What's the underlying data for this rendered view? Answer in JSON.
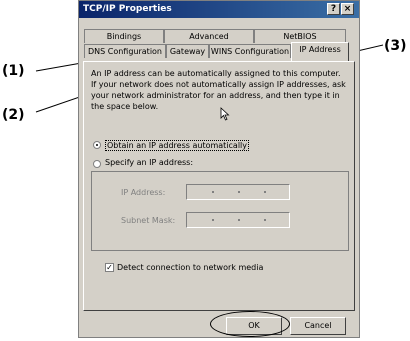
{
  "dialog": {
    "title": "TCP/IP Properties",
    "help_button": "?",
    "close_button": "×"
  },
  "tabs": {
    "row_back": [
      "Bindings",
      "Advanced",
      "NetBIOS"
    ],
    "row_front": [
      "DNS Configuration",
      "Gateway",
      "WINS Configuration",
      "IP Address"
    ]
  },
  "description": "An IP address can be automatically assigned to this computer. If your network does not automatically assign IP addresses, ask your network administrator for an address, and then type it in the space below.",
  "options": {
    "obtain_auto": "Obtain an IP address automatically",
    "specify": "Specify an IP address:"
  },
  "fields": {
    "ip_label": "IP Address:",
    "subnet_label": "Subnet Mask:"
  },
  "detect_label": "Detect connection to network media",
  "buttons": {
    "ok": "OK",
    "cancel": "Cancel"
  },
  "callouts": [
    "(1)",
    "(2)",
    "(3)"
  ]
}
